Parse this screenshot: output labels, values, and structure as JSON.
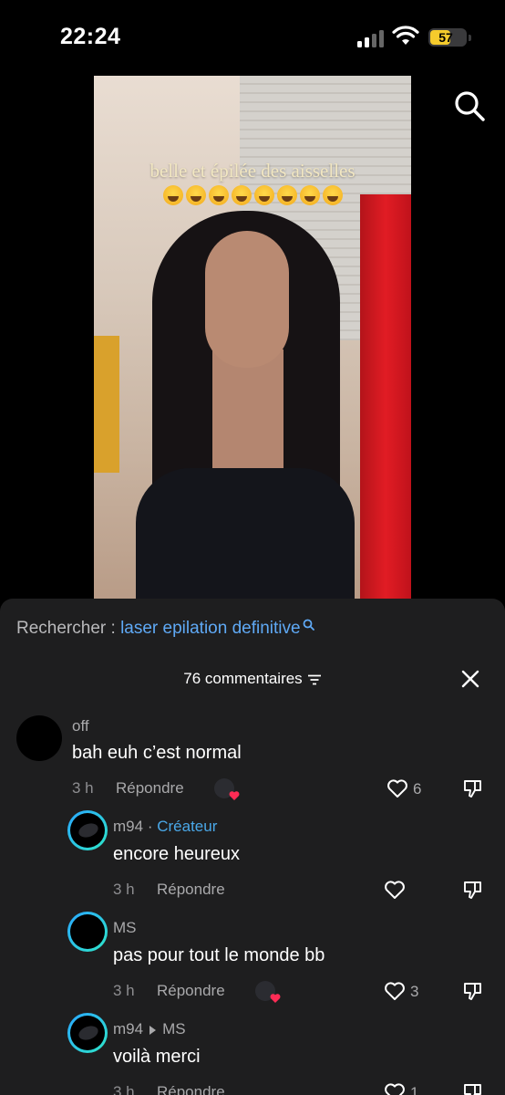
{
  "status_bar": {
    "time": "22:24",
    "battery_level": "57",
    "battery_fraction": 0.57,
    "battery_color": "#f5cb2c"
  },
  "video": {
    "caption": "belle et épilée des aisselles",
    "emoji_name": "face-with-tears-of-joy-emoji",
    "emoji_count": 8
  },
  "search": {
    "label": "Rechercher :",
    "query": "laser epilation definitive",
    "link_color": "#5fa9f5"
  },
  "comments_header": {
    "count_label": "76 commentaires"
  },
  "comments": [
    {
      "username": "off",
      "text": "bah euh c’est normal",
      "time": "3 h",
      "reply_label": "Répondre",
      "likes": "6",
      "liked_by_creator": true
    },
    {
      "username": "m94",
      "creator_label": "Créateur",
      "separator": "·",
      "text": "encore heureux",
      "time": "3 h",
      "reply_label": "Répondre",
      "likes": "",
      "liked_by_creator": false
    },
    {
      "username": "MS",
      "text": "pas pour tout le monde bb",
      "time": "3 h",
      "reply_label": "Répondre",
      "likes": "3",
      "liked_by_creator": true
    },
    {
      "username": "m94",
      "reply_to": "MS",
      "text": "voilà merci",
      "time": "3 h",
      "reply_label": "Répondre",
      "likes": "1",
      "liked_by_creator": false
    }
  ],
  "accent_colors": {
    "creator_blue": "#4aa8e8",
    "heart_red": "#fe2c55",
    "sheet_bg": "#1e1e1f"
  }
}
